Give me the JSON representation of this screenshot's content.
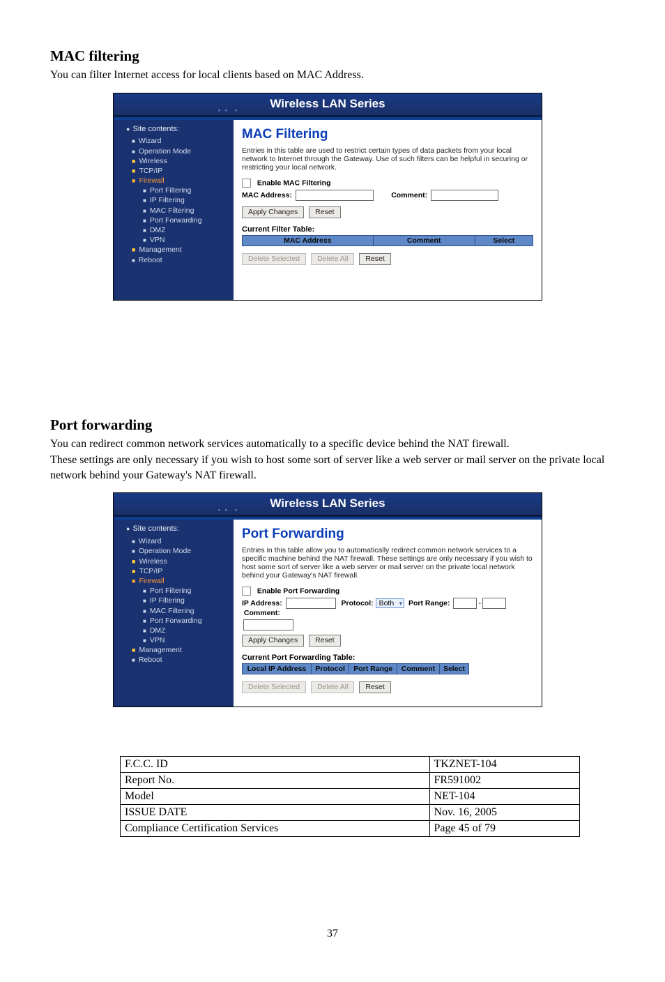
{
  "headings": {
    "h1_mac": "MAC filtering",
    "p1_mac": "You can filter Internet access for local clients based on MAC Address.",
    "h1_pf": "Port forwarding",
    "p1_pf": "You can redirect common network services automatically to a specific device behind the NAT firewall.",
    "p2_pf": "These settings are only necessary if you wish to host some sort of server like a web server or mail server on the private local network behind your Gateway's NAT firewall."
  },
  "router": {
    "product": "Wireless LAN Series",
    "site_contents": "Site contents:",
    "sidebar": [
      "Wizard",
      "Operation Mode",
      "Wireless",
      "TCP/IP",
      "Firewall",
      "Port Filtering",
      "IP Filtering",
      "MAC Filtering",
      "Port Forwarding",
      "DMZ",
      "VPN",
      "Management",
      "Reboot"
    ]
  },
  "mac_page": {
    "title": "MAC Filtering",
    "desc": "Entries in this table are used to restrict certain types of data packets from your local network to Internet through the Gateway. Use of such filters can be helpful in securing or restricting your local network.",
    "enable": "Enable MAC Filtering",
    "mac_addr": "MAC Address:",
    "comment": "Comment:",
    "apply": "Apply Changes",
    "reset": "Reset",
    "cur_tbl": "Current Filter Table:",
    "cols": {
      "mac": "MAC Address",
      "comment": "Comment",
      "select": "Select"
    },
    "del_sel": "Delete Selected",
    "del_all": "Delete All",
    "reset2": "Reset"
  },
  "pf_page": {
    "title": "Port Forwarding",
    "desc": "Entries in this table allow you to automatically redirect common network services to a specific machine behind the NAT firewall. These settings are only necessary if you wish to host some sort of server like a web server or mail server on the private local network behind your Gateway's NAT firewall.",
    "enable": "Enable Port Forwarding",
    "ip": "IP Address:",
    "proto": "Protocol:",
    "proto_val": "Both",
    "port_range": "Port Range:",
    "comment": "Comment:",
    "apply": "Apply Changes",
    "reset": "Reset",
    "cur_tbl": "Current Port Forwarding Table:",
    "cols": {
      "ip": "Local IP Address",
      "proto": "Protocol",
      "port": "Port Range",
      "comment": "Comment",
      "select": "Select"
    },
    "del_sel": "Delete Selected",
    "del_all": "Delete All",
    "reset2": "Reset"
  },
  "info_table": {
    "rows": [
      {
        "c1": "F.C.C. ID",
        "c2": "TKZNET-104"
      },
      {
        "c1": "Report No.",
        "c2": "FR591002"
      },
      {
        "c1": "Model",
        "c2": "NET-104"
      },
      {
        "c1": "ISSUE DATE",
        "c2": "Nov. 16, 2005"
      },
      {
        "c1": "Compliance Certification Services",
        "c2": "Page 45 of 79"
      }
    ]
  },
  "page_number": "37"
}
